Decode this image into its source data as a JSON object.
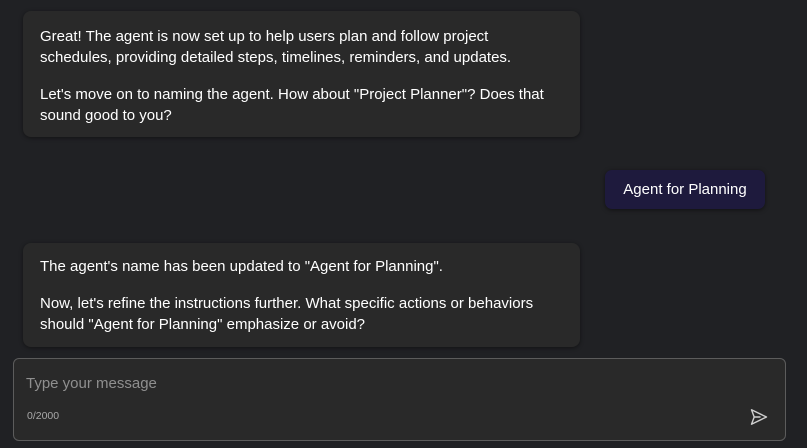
{
  "messages": {
    "agent_1": {
      "para_1": "Great! The agent is now set up to help users plan and follow project schedules, providing detailed steps, timelines, reminders, and updates.",
      "para_2": "Let's move on to naming the agent. How about \"Project Planner\"? Does that sound good to you?"
    },
    "user_1": {
      "text": "Agent for Planning"
    },
    "agent_2": {
      "para_1": "The agent's name has been updated to \"Agent for Planning\".",
      "para_2": "Now, let's refine the instructions further. What specific actions or behaviors should \"Agent for Planning\" emphasize or avoid?"
    }
  },
  "composer": {
    "placeholder": "Type your message",
    "value": "",
    "counter": "0/2000",
    "send_icon": "send-icon"
  },
  "colors": {
    "background": "#202124",
    "agent_bubble": "#292929",
    "user_bubble": "#1e1a3d",
    "text": "#ffffff",
    "placeholder": "#8f8f8f"
  }
}
